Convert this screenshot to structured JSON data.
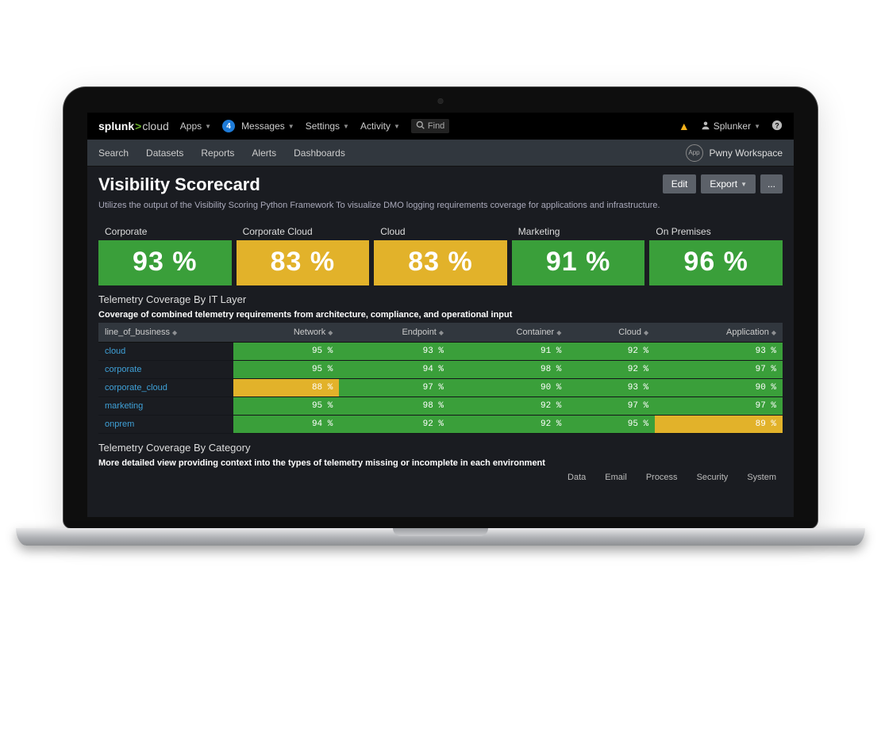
{
  "brand": {
    "name": "splunk",
    "gt": ">",
    "suffix": "cloud"
  },
  "topnav": {
    "apps": "Apps",
    "messages_badge": "4",
    "messages": "Messages",
    "settings": "Settings",
    "activity": "Activity",
    "search_placeholder": "Find",
    "user": "Splunker"
  },
  "subnav": {
    "items": [
      "Search",
      "Datasets",
      "Reports",
      "Alerts",
      "Dashboards"
    ],
    "app_label": "App",
    "workspace": "Pwny Workspace"
  },
  "page": {
    "title": "Visibility Scorecard",
    "desc": "Utilizes the output of the Visibility Scoring Python Framework To visualize DMO logging requirements coverage for applications and infrastructure.",
    "edit": "Edit",
    "export": "Export",
    "more": "..."
  },
  "cards": [
    {
      "label": "Corporate",
      "value": "93 %",
      "color": "green"
    },
    {
      "label": "Corporate Cloud",
      "value": "83 %",
      "color": "yellow"
    },
    {
      "label": "Cloud",
      "value": "83 %",
      "color": "yellow"
    },
    {
      "label": "Marketing",
      "value": "91 %",
      "color": "green"
    },
    {
      "label": "On Premises",
      "value": "96 %",
      "color": "green"
    }
  ],
  "section1": {
    "title": "Telemetry Coverage By IT Layer",
    "desc": "Coverage of combined telemetry requirements from architecture, compliance, and operational input",
    "columns": [
      "line_of_business",
      "Network",
      "Endpoint",
      "Container",
      "Cloud",
      "Application"
    ]
  },
  "chart_data": {
    "type": "table",
    "title": "Telemetry Coverage By IT Layer",
    "columns": [
      "Network",
      "Endpoint",
      "Container",
      "Cloud",
      "Application"
    ],
    "rows": [
      {
        "lob": "cloud",
        "values": [
          95,
          93,
          91,
          92,
          93
        ],
        "flags": [
          "g",
          "g",
          "g",
          "g",
          "g"
        ]
      },
      {
        "lob": "corporate",
        "values": [
          95,
          94,
          98,
          92,
          97
        ],
        "flags": [
          "g",
          "g",
          "g",
          "g",
          "g"
        ]
      },
      {
        "lob": "corporate_cloud",
        "values": [
          88,
          97,
          90,
          93,
          90
        ],
        "flags": [
          "y",
          "g",
          "g",
          "g",
          "g"
        ]
      },
      {
        "lob": "marketing",
        "values": [
          95,
          98,
          92,
          97,
          97
        ],
        "flags": [
          "g",
          "g",
          "g",
          "g",
          "g"
        ]
      },
      {
        "lob": "onprem",
        "values": [
          94,
          92,
          92,
          95,
          89
        ],
        "flags": [
          "g",
          "g",
          "g",
          "g",
          "y"
        ]
      }
    ],
    "unit": "%",
    "legend": {
      "g": "#3a9f3a",
      "y": "#e2b22a"
    }
  },
  "section2": {
    "title": "Telemetry Coverage By Category",
    "desc": "More detailed view providing context into the types of telemetry missing or incomplete in each environment",
    "partial_columns": [
      "Data",
      "Email",
      "Process",
      "Security",
      "System"
    ]
  }
}
